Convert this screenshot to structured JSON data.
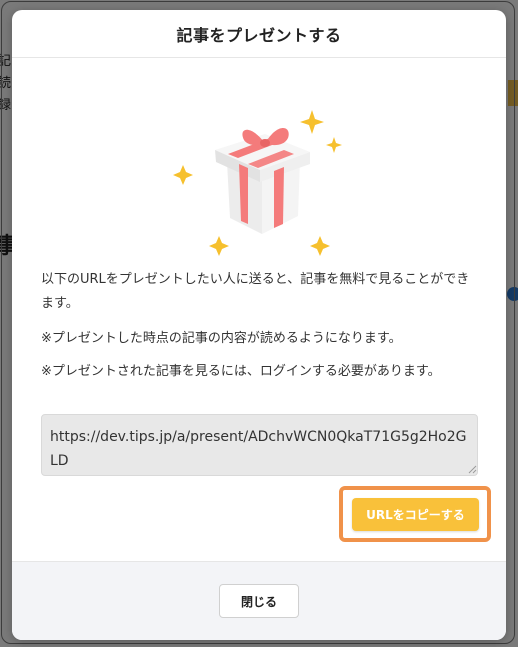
{
  "modal": {
    "title": "記事をプレゼントする",
    "description_1": "以下のURLをプレゼントしたい人に送ると、記事を無料で見ることができます。",
    "description_2": "※プレゼントした時点の記事の内容が読めるようになります。",
    "description_3": "※プレゼントされた記事を見るには、ログインする必要があります。",
    "url": "https://dev.tips.jp/a/present/ADchvWCN0QkaT71G5g2Ho2GLD",
    "copy_label": "URLをコピーする",
    "close_label": "閉じる"
  },
  "colors": {
    "accent": "#f9c13a",
    "highlight": "#f0924a",
    "ribbon": "#f47b7b",
    "sparkle": "#f6c02e",
    "footer_bg": "#f3f4f7"
  },
  "icons": {
    "gift": "gift-icon",
    "sparkle": "sparkle-icon"
  }
}
